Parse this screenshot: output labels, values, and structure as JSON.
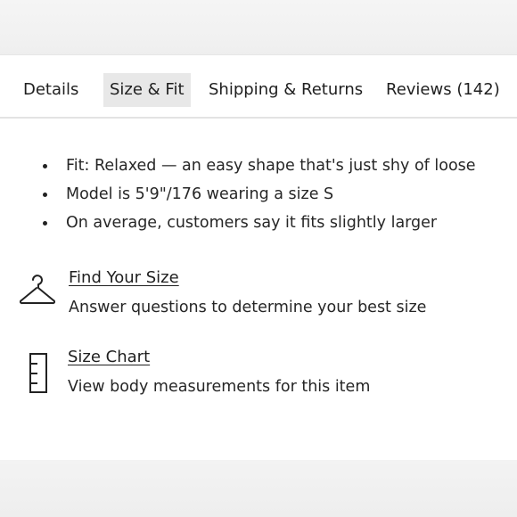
{
  "tabs": [
    {
      "label": "Details",
      "active": false
    },
    {
      "label": "Size & Fit",
      "active": true
    },
    {
      "label": "Shipping & Returns",
      "active": false
    },
    {
      "label": "Reviews (142)",
      "active": false
    }
  ],
  "fit_notes": [
    "Fit: Relaxed — an easy shape that's just shy of loose",
    "Model is 5'9\"/176 wearing a size S",
    "On average, customers say it fits slightly larger"
  ],
  "find_size": {
    "title": "Find Your Size",
    "description": "Answer questions to determine your best size",
    "icon": "hanger-icon"
  },
  "size_chart": {
    "title": "Size Chart",
    "description": "View body measurements for this item",
    "icon": "ruler-icon"
  },
  "colors": {
    "active_tab_bg": "#e8e8e8",
    "text": "#222222",
    "divider": "#e3e3e3"
  }
}
